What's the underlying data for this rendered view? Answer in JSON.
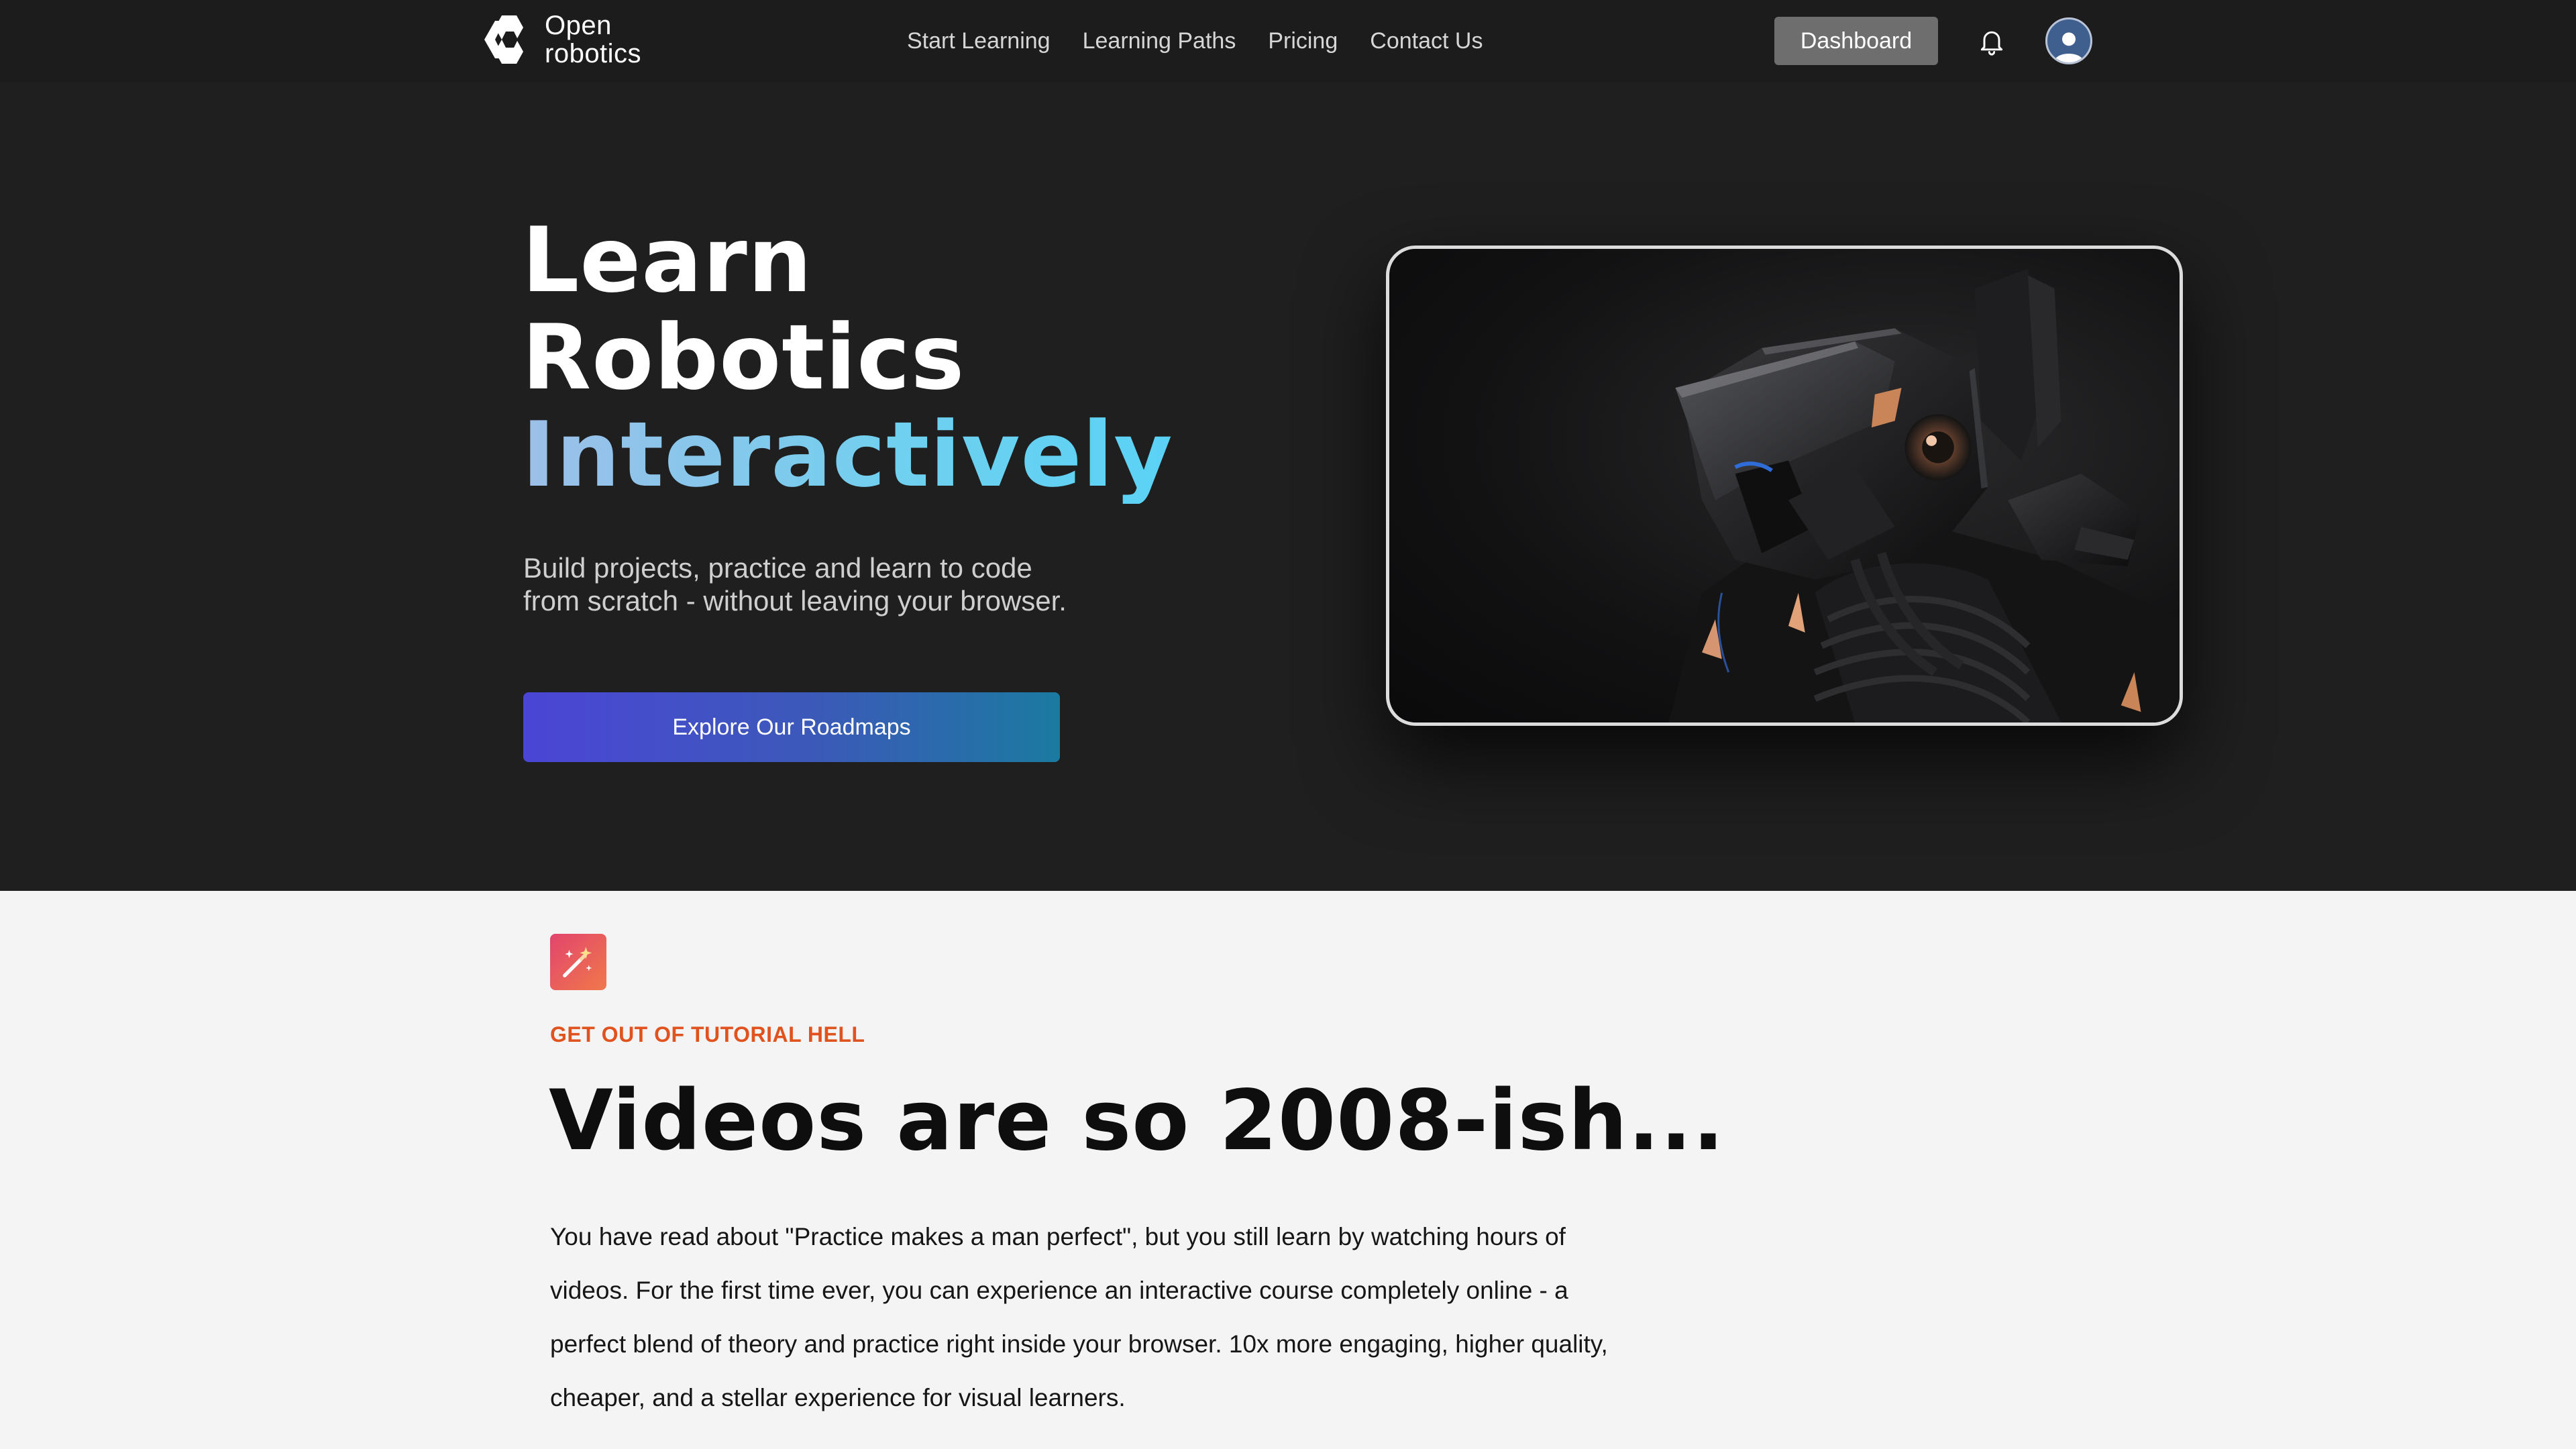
{
  "nav": {
    "logo_line1": "Open",
    "logo_line2": "robotics",
    "links": [
      "Start Learning",
      "Learning Paths",
      "Pricing",
      "Contact Us"
    ],
    "dashboard_label": "Dashboard"
  },
  "hero": {
    "title_line1": "Learn",
    "title_line2": "Robotics",
    "title_line3": "Interactively",
    "subtitle": "Build projects, practice and learn to code from scratch - without leaving your browser.",
    "cta_label": "Explore Our Roadmaps"
  },
  "feature": {
    "eyebrow": "GET OUT OF TUTORIAL HELL",
    "title": "Videos are so 2008-ish...",
    "body": "You have read about \"Practice makes a man perfect\", but you still learn by watching hours of videos. For the first time ever, you can experience an interactive course completely online - a perfect blend of theory and practice right inside your browser. 10x more engaging, higher quality, cheaper, and a stellar experience for visual learners."
  },
  "icons": {
    "logo": "open-robotics-logo-icon",
    "bell": "bell-icon",
    "avatar": "user-avatar-icon",
    "feature": "magic-wand-icon"
  },
  "colors": {
    "nav_bg": "#1c1c1d",
    "hero_bg": "#1f1f20",
    "section_bg": "#f4f4f4",
    "eyebrow": "#e0531f",
    "cta_start": "#4b45d6",
    "cta_end": "#1b7aa0"
  }
}
